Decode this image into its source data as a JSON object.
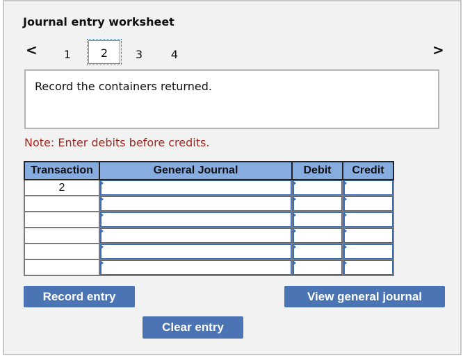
{
  "worksheet": {
    "title": "Journal entry worksheet",
    "nav": {
      "prev_icon": "‹",
      "next_icon": "›"
    },
    "tabs": [
      {
        "label": "1",
        "active": false
      },
      {
        "label": "2",
        "active": true
      },
      {
        "label": "3",
        "active": false
      },
      {
        "label": "4",
        "active": false
      }
    ],
    "description": "Record the containers returned.",
    "note": "Note: Enter debits before credits."
  },
  "journal_table": {
    "headers": [
      "Transaction",
      "General Journal",
      "Debit",
      "Credit"
    ],
    "rows": [
      {
        "transaction": "2",
        "account": "",
        "debit": "",
        "credit": ""
      },
      {
        "transaction": "",
        "account": "",
        "debit": "",
        "credit": ""
      },
      {
        "transaction": "",
        "account": "",
        "debit": "",
        "credit": ""
      },
      {
        "transaction": "",
        "account": "",
        "debit": "",
        "credit": ""
      },
      {
        "transaction": "",
        "account": "",
        "debit": "",
        "credit": ""
      },
      {
        "transaction": "",
        "account": "",
        "debit": "",
        "credit": ""
      }
    ]
  },
  "buttons": {
    "record": "Record entry",
    "clear": "Clear entry",
    "view": "View general journal"
  },
  "colors": {
    "accent": "#4a74b3",
    "header_bg": "#87ace0",
    "note_text": "#a4261d"
  }
}
